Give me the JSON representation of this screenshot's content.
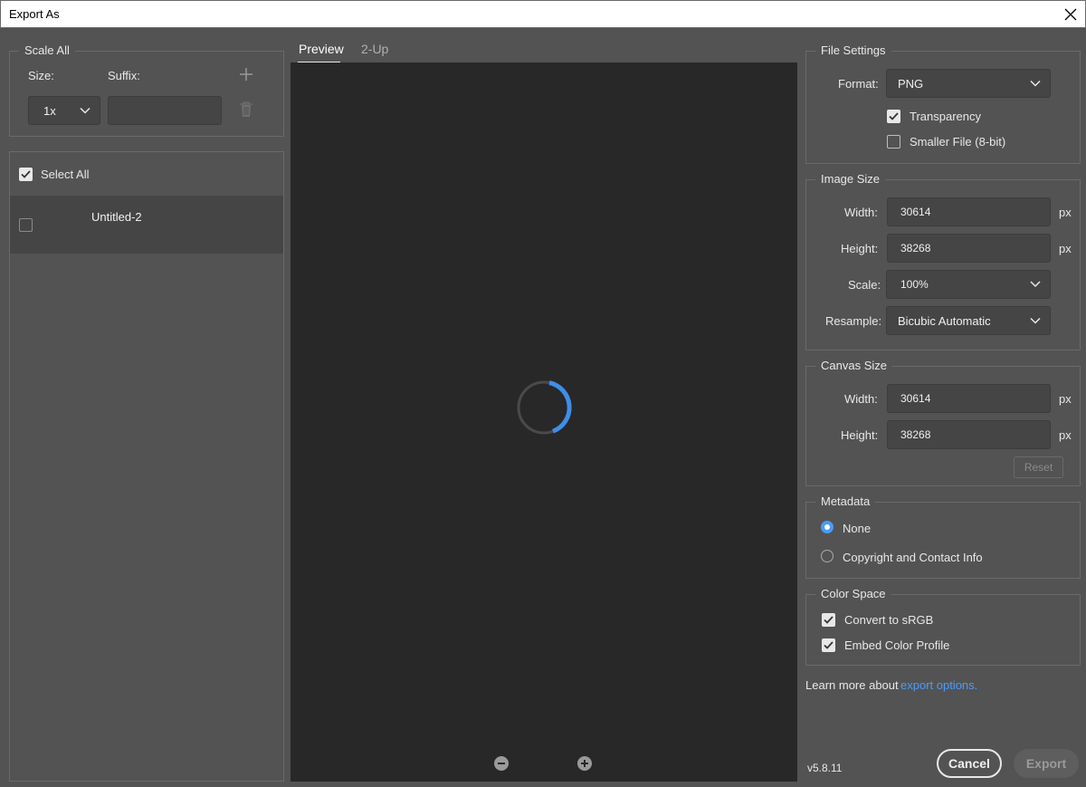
{
  "window": {
    "title": "Export As"
  },
  "scale_all": {
    "title": "Scale All",
    "size_label": "Size:",
    "suffix_label": "Suffix:",
    "size_value": "1x",
    "suffix_value": ""
  },
  "asset_list": {
    "select_all_label": "Select All",
    "select_all_checked": true,
    "items": [
      {
        "name": "Untitled-2",
        "checked": false
      }
    ]
  },
  "preview": {
    "tabs": [
      {
        "label": "Preview",
        "active": true
      },
      {
        "label": "2-Up",
        "active": false
      }
    ]
  },
  "file_settings": {
    "title": "File Settings",
    "format_label": "Format:",
    "format_value": "PNG",
    "transparency_label": "Transparency",
    "transparency_checked": true,
    "smaller_file_label": "Smaller File (8-bit)",
    "smaller_file_checked": false
  },
  "image_size": {
    "title": "Image Size",
    "width_label": "Width:",
    "width_value": "30614",
    "height_label": "Height:",
    "height_value": "38268",
    "scale_label": "Scale:",
    "scale_value": "100%",
    "resample_label": "Resample:",
    "resample_value": "Bicubic Automatic",
    "unit": "px"
  },
  "canvas_size": {
    "title": "Canvas Size",
    "width_label": "Width:",
    "width_value": "30614",
    "height_label": "Height:",
    "height_value": "38268",
    "unit": "px",
    "reset_label": "Reset"
  },
  "metadata": {
    "title": "Metadata",
    "options": [
      {
        "label": "None",
        "selected": true
      },
      {
        "label": "Copyright and Contact Info",
        "selected": false
      }
    ]
  },
  "color_space": {
    "title": "Color Space",
    "convert_label": "Convert to sRGB",
    "convert_checked": true,
    "embed_label": "Embed Color Profile",
    "embed_checked": true
  },
  "footer": {
    "learn_more_text": "Learn more about ",
    "learn_more_link": "export options.",
    "version": "v5.8.11",
    "cancel_label": "Cancel",
    "export_label": "Export"
  },
  "colors": {
    "accent": "#4b9cf5",
    "background": "#535353",
    "preview_bg": "#282828"
  }
}
